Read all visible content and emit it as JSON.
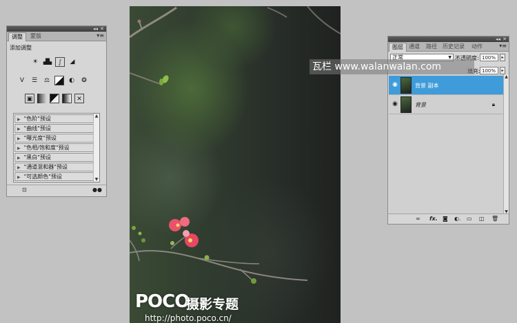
{
  "adjustments_panel": {
    "tabs": [
      "调整",
      "蒙版"
    ],
    "header": "添加调整",
    "icon_rows": [
      [
        "brightness-contrast-icon",
        "levels-icon",
        "curves-icon",
        "exposure-icon"
      ],
      [
        "vibrance-icon",
        "hue-saturation-icon",
        "color-balance-icon",
        "black-white-icon",
        "photo-filter-icon",
        "channel-mixer-icon"
      ],
      [
        "invert-icon",
        "posterize-icon",
        "threshold-icon",
        "gradient-map-icon",
        "selective-color-icon"
      ]
    ],
    "presets": [
      "\"色阶\"预设",
      "\"曲线\"预设",
      "\"曝光度\"预设",
      "\"色相/饱和度\"预设",
      "\"黑白\"预设",
      "\"通道混和器\"预设",
      "\"可选颜色\"预设"
    ]
  },
  "layers_panel": {
    "tabs": [
      "图层",
      "通道",
      "路径",
      "历史记录",
      "动作"
    ],
    "blend_mode": "正常",
    "opacity_label": "不透明度:",
    "opacity_value": "100%",
    "fill_label": "填充:",
    "fill_value": "100%",
    "layers": [
      {
        "name": "背景 副本",
        "selected": true,
        "locked": false
      },
      {
        "name": "背景",
        "selected": false,
        "locked": true
      }
    ]
  },
  "banner": {
    "text": "瓦栏 www.walanwalan.com"
  },
  "photo_watermark": {
    "logo": "POCO",
    "title": "摄影专题",
    "url": "http://photo.poco.cn/"
  },
  "colors": {
    "selection_blue": "#3f9bd9",
    "panel_gray": "#d6d6d6",
    "workspace_gray": "#c2c2c2"
  }
}
